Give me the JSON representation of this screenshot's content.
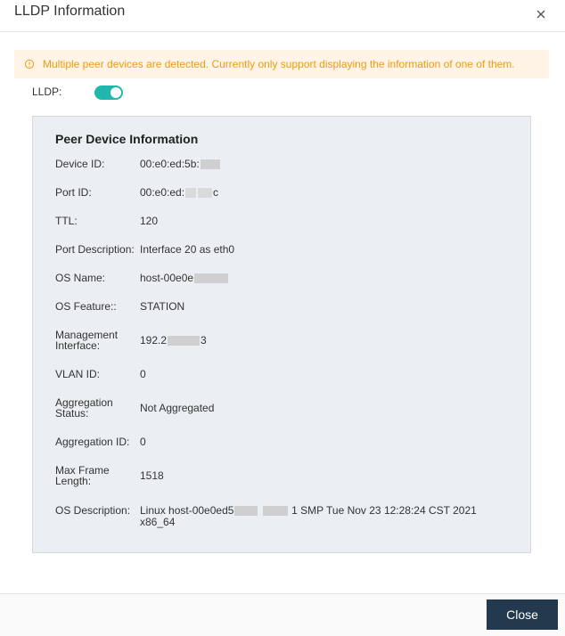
{
  "dialog": {
    "title": "LLDP Information",
    "close_icon": "close-icon"
  },
  "alert": {
    "icon": "info-circle-icon",
    "text": "Multiple peer devices are detected. Currently only support displaying the information of one of them.",
    "color": "#f29a0f",
    "background": "#fff4e5"
  },
  "lldp": {
    "label": "LLDP:",
    "enabled": true,
    "accent": "#22b7ad"
  },
  "peer": {
    "title": "Peer Device Information",
    "fields": [
      {
        "label": "Device ID:",
        "value_prefix": "00:e0:ed:5b:",
        "value_suffix": ""
      },
      {
        "label": "Port ID:",
        "value_prefix": "00:e0:ed:",
        "value_suffix": "c"
      },
      {
        "label": "TTL:",
        "value_prefix": "120",
        "value_suffix": ""
      },
      {
        "label": "Port Description:",
        "value_prefix": "Interface 20 as eth0",
        "value_suffix": ""
      },
      {
        "label": "OS Name:",
        "value_prefix": "host-00e0e",
        "value_suffix": ""
      },
      {
        "label": "OS Feature::",
        "value_prefix": "STATION",
        "value_suffix": ""
      },
      {
        "label": "Management Interface:",
        "value_prefix": "192.2",
        "value_suffix": "3"
      },
      {
        "label": "VLAN ID:",
        "value_prefix": "0",
        "value_suffix": ""
      },
      {
        "label": "Aggregation Status:",
        "value_prefix": "Not Aggregated",
        "value_suffix": ""
      },
      {
        "label": "Aggregation ID:",
        "value_prefix": "0",
        "value_suffix": ""
      },
      {
        "label": "Max Frame Length:",
        "value_prefix": "1518",
        "value_suffix": ""
      },
      {
        "label": "OS Description:",
        "value_prefix": "Linux host-00e0ed5",
        "value_suffix": "1 SMP Tue Nov 23 12:28:24 CST 2021 x86_64"
      }
    ]
  },
  "footer": {
    "close_label": "Close",
    "button_color": "#233a4e"
  }
}
